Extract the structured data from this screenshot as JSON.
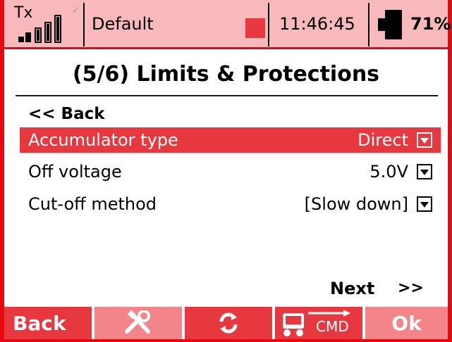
{
  "status_bar": {
    "tx_label": "Tx",
    "model_name": "Default",
    "time": "11:46:45",
    "battery_percent": "71%",
    "battery_level": 0.71,
    "signal_bars_lit": 5
  },
  "page": {
    "title": "(5/6) Limits & Protections"
  },
  "menu": {
    "back_label": "<< Back",
    "rows": [
      {
        "label": "Accumulator type",
        "value": "Direct",
        "selected": true
      },
      {
        "label": "Off voltage",
        "value": "5.0V",
        "selected": false
      },
      {
        "label": "Cut-off method",
        "value": "[Slow down]",
        "selected": false
      }
    ],
    "next_label": "Next",
    "next_arrows": ">>"
  },
  "softkeys": {
    "back_label": "Back",
    "ok_label": "Ok",
    "cmd_label": "CMD",
    "icons": [
      "tools-icon",
      "sync-icon",
      "transmitter-cmd-icon"
    ]
  },
  "colors": {
    "frame": "#e8080f",
    "accent": "#e8383f",
    "status_bg": "#f7b9bb",
    "softkey_dim": "#f2848a"
  }
}
